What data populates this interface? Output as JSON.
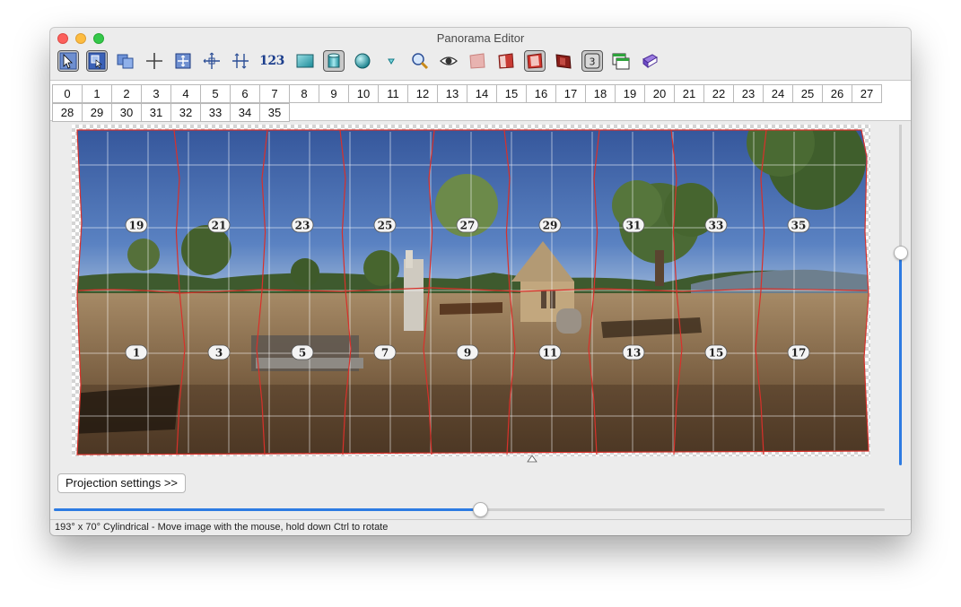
{
  "window": {
    "title": "Panorama Editor"
  },
  "toolbar": {
    "buttons": [
      {
        "name": "select-tool-icon",
        "pressed": true
      },
      {
        "name": "images-icon",
        "pressed": true
      },
      {
        "name": "layers-icon",
        "pressed": false
      },
      {
        "name": "crosshair-icon",
        "pressed": false
      },
      {
        "name": "fit-icon",
        "pressed": false
      },
      {
        "name": "center-icon",
        "pressed": false
      },
      {
        "name": "straighten-icon",
        "pressed": false
      },
      {
        "name": "number-labels-icon",
        "label": "123",
        "pressed": false
      },
      {
        "name": "rectilinear-icon",
        "pressed": false
      },
      {
        "name": "cylinder-icon",
        "pressed": true
      },
      {
        "name": "sphere-icon",
        "pressed": false
      },
      {
        "name": "triangle-down-icon",
        "pressed": false
      },
      {
        "name": "magnifier-icon",
        "pressed": false
      },
      {
        "name": "eye-icon",
        "pressed": false
      },
      {
        "name": "blend-faint-icon",
        "pressed": false
      },
      {
        "name": "blend-icon",
        "pressed": false
      },
      {
        "name": "blend-active-icon",
        "pressed": true
      },
      {
        "name": "blend-dark-icon",
        "pressed": false
      },
      {
        "name": "image-number-icon",
        "label": "3",
        "pressed": true
      },
      {
        "name": "window-icon",
        "pressed": false
      },
      {
        "name": "book-icon",
        "pressed": false
      }
    ]
  },
  "image_tabs": {
    "row1": [
      "0",
      "1",
      "2",
      "3",
      "4",
      "5",
      "6",
      "7",
      "8",
      "9",
      "10",
      "11",
      "12",
      "13",
      "14",
      "15",
      "16",
      "17",
      "18",
      "19",
      "20",
      "21",
      "22",
      "23",
      "24",
      "25",
      "26",
      "27"
    ],
    "row2": [
      "28",
      "29",
      "30",
      "31",
      "32",
      "33",
      "34",
      "35"
    ]
  },
  "preview": {
    "top_labels": [
      "19",
      "21",
      "23",
      "25",
      "27",
      "29",
      "31",
      "33",
      "35"
    ],
    "bottom_labels": [
      "1",
      "3",
      "5",
      "7",
      "9",
      "11",
      "13",
      "15",
      "17"
    ]
  },
  "projection_button": "Projection settings >>",
  "status": "193° x 70° Cylindrical - Move image with the mouse, hold down Ctrl to rotate",
  "colors": {
    "accent": "#2d7be2",
    "seam": "#d9302a",
    "sky": "#3f65a8",
    "ground": "#8a6b48"
  },
  "sliders": {
    "horizontal_value": 0.514,
    "vertical_value": 0.37
  }
}
